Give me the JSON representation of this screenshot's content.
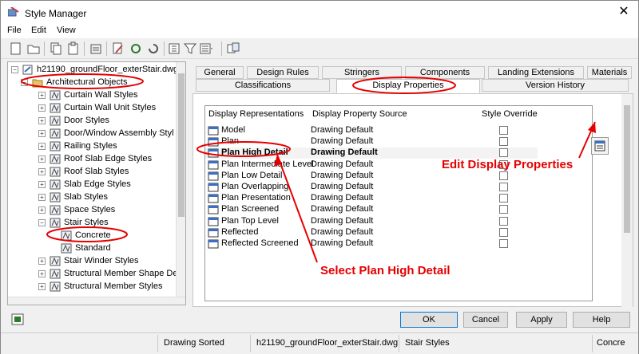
{
  "window": {
    "title": "Style Manager",
    "close": "✕"
  },
  "menu": [
    "File",
    "Edit",
    "View"
  ],
  "toolbar_icons": [
    "new-icon",
    "open-icon",
    "copy-icon",
    "paste-icon",
    "purge-icon",
    "edit-style-icon",
    "sync-icon",
    "refresh-icon",
    "filter-icon",
    "view-icon",
    "toggle-icon"
  ],
  "tree": {
    "root": "h21190_groundFloor_exterStair.dwg",
    "category": "Architectural Objects",
    "items": [
      "Curtain Wall Styles",
      "Curtain Wall Unit Styles",
      "Door Styles",
      "Door/Window Assembly Styl",
      "Railing Styles",
      "Roof Slab Edge Styles",
      "Roof Slab Styles",
      "Slab Edge Styles",
      "Slab Styles",
      "Space Styles",
      "Stair Styles"
    ],
    "stair_children": [
      "Concrete",
      "Standard"
    ],
    "after_items": [
      "Stair Winder Styles",
      "Structural Member Shape De",
      "Structural Member Styles"
    ]
  },
  "tabs_top": [
    "General",
    "Design Rules",
    "Stringers",
    "Components",
    "Landing Extensions",
    "Materials"
  ],
  "tabs_bottom": [
    "Classifications",
    "Display Properties",
    "Version History"
  ],
  "grid": {
    "headers": [
      "Display Representations",
      "Display Property Source",
      "Style Override"
    ],
    "rows": [
      {
        "name": "Model",
        "source": "Drawing Default",
        "selected": false
      },
      {
        "name": "Plan",
        "source": "Drawing Default",
        "selected": false
      },
      {
        "name": "Plan High Detail",
        "source": "Drawing Default",
        "selected": true
      },
      {
        "name": "Plan Intermediate Level",
        "source": "Drawing Default",
        "selected": false
      },
      {
        "name": "Plan Low Detail",
        "source": "Drawing Default",
        "selected": false
      },
      {
        "name": "Plan Overlapping",
        "source": "Drawing Default",
        "selected": false
      },
      {
        "name": "Plan Presentation",
        "source": "Drawing Default",
        "selected": false
      },
      {
        "name": "Plan Screened",
        "source": "Drawing Default",
        "selected": false
      },
      {
        "name": "Plan Top Level",
        "source": "Drawing Default",
        "selected": false
      },
      {
        "name": "Reflected",
        "source": "Drawing Default",
        "selected": false
      },
      {
        "name": "Reflected Screened",
        "source": "Drawing Default",
        "selected": false
      }
    ]
  },
  "annotations": {
    "edit": "Edit Display Properties",
    "select": "Select Plan High Detail"
  },
  "buttons": {
    "ok": "OK",
    "cancel": "Cancel",
    "apply": "Apply",
    "help": "Help"
  },
  "status": [
    "Drawing Sorted",
    "h21190_groundFloor_exterStair.dwg",
    "Stair Styles",
    "Concre"
  ],
  "colors": {
    "annotation": "#e60000",
    "folder": "#e8c468",
    "accent": "#0078d7"
  }
}
